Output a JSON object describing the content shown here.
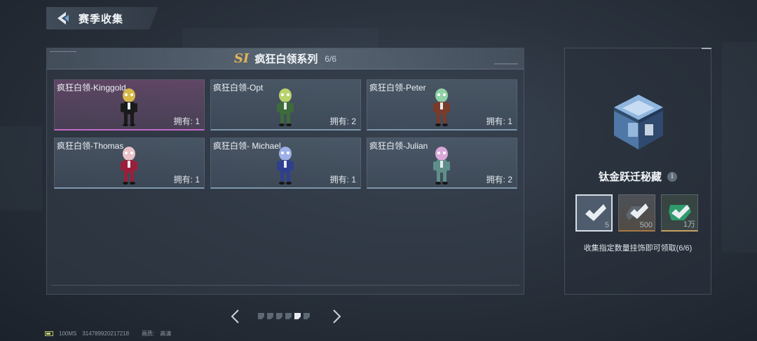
{
  "header": {
    "title": "赛季收集"
  },
  "series": {
    "badge": "SI",
    "title": "疯狂白领系列",
    "count": "6/6"
  },
  "items": [
    {
      "name": "疯狂白领-Kinggold",
      "owned": "拥有: 1",
      "rarity": "rare",
      "figure_color": "#1a1a1a",
      "accent_color": "#d9b84a"
    },
    {
      "name": "疯狂白领-Opt",
      "owned": "拥有: 2",
      "rarity": "normal",
      "figure_color": "#3d6b3a",
      "accent_color": "#b9d36b"
    },
    {
      "name": "疯狂白领-Peter",
      "owned": "拥有: 1",
      "rarity": "normal",
      "figure_color": "#7a3b2a",
      "accent_color": "#8fd0a6"
    },
    {
      "name": "疯狂白领-Thomas",
      "owned": "拥有: 1",
      "rarity": "normal",
      "figure_color": "#9b1f3a",
      "accent_color": "#e7c3c9"
    },
    {
      "name": "疯狂白领- Michael",
      "owned": "拥有: 1",
      "rarity": "normal",
      "figure_color": "#2f3f8f",
      "accent_color": "#9eb0e8"
    },
    {
      "name": "疯狂白领-Julian",
      "owned": "拥有: 2",
      "rarity": "normal",
      "figure_color": "#5f8f8a",
      "accent_color": "#d8a8d8"
    }
  ],
  "pagination": {
    "total": 6,
    "current": 5
  },
  "reward": {
    "name": "钛金跃迁秘藏",
    "info_icon": "i",
    "tiers": [
      {
        "qty": "5",
        "icon": "check-icon",
        "selected": true
      },
      {
        "qty": "500",
        "icon": "check-icon",
        "selected": false
      },
      {
        "qty": "1万",
        "icon": "check-icon",
        "selected": false
      }
    ],
    "description": "收集指定数量挂饰即可领取(6/6)"
  },
  "footer": {
    "latency": "100MS",
    "id": "314789920217218",
    "quality_label": "画质:",
    "quality_value": "高清"
  }
}
